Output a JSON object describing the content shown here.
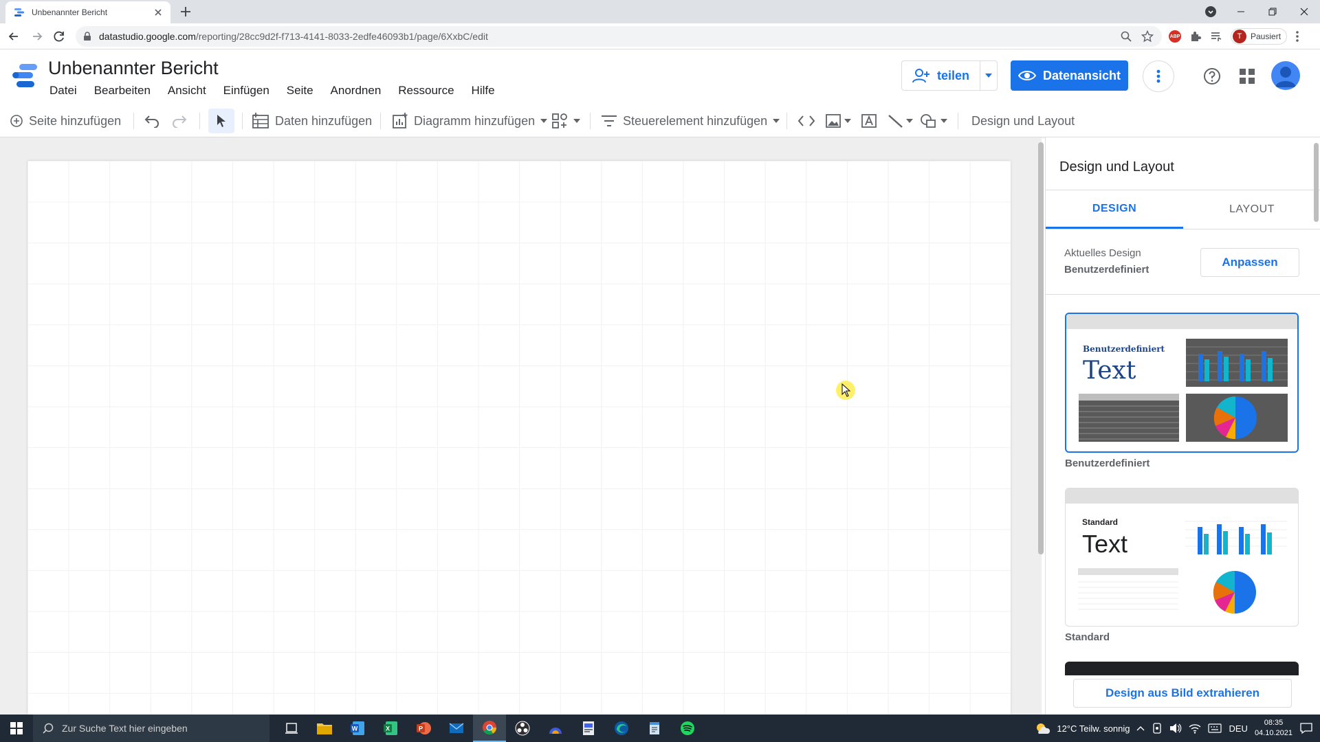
{
  "browser": {
    "tab_title": "Unbenannter Bericht",
    "url_host": "datastudio.google.com",
    "url_path": "/reporting/28cc9d2f-f713-4141-8033-2edfe46093b1/page/6XxbC/edit",
    "profile_initial": "T",
    "profile_status": "Pausiert",
    "abp_label": "ABP"
  },
  "header": {
    "report_title": "Unbenannter Bericht",
    "menu": [
      "Datei",
      "Bearbeiten",
      "Ansicht",
      "Einfügen",
      "Seite",
      "Anordnen",
      "Ressource",
      "Hilfe"
    ],
    "share_label": "teilen",
    "view_label": "Datenansicht"
  },
  "toolbar": {
    "add_page": "Seite hinzufügen",
    "add_data": "Daten hinzufügen",
    "add_chart": "Diagramm hinzufügen",
    "add_control": "Steuerelement hinzufügen",
    "theme_layout": "Design und Layout"
  },
  "panel": {
    "title": "Design und Layout",
    "tabs": [
      "DESIGN",
      "LAYOUT"
    ],
    "active_tab": "DESIGN",
    "current_label": "Aktuelles Design",
    "current_value": "Benutzerdefiniert",
    "customize_label": "Anpassen",
    "themes": [
      {
        "preview_title": "Benutzerdefiniert",
        "preview_text": "Text",
        "name": "Benutzerdefiniert",
        "selected": true
      },
      {
        "preview_title": "Standard",
        "preview_text": "Text",
        "name": "Standard",
        "selected": false
      }
    ],
    "extract_label": "Design aus Bild extrahieren"
  },
  "taskbar": {
    "search_placeholder": "Zur Suche Text hier eingeben",
    "weather": "12°C  Teilw. sonnig",
    "language": "DEU",
    "time": "08:35",
    "date": "04.10.2021"
  },
  "colors": {
    "accent": "#1a73e8",
    "custom_theme_blue": "#1c4587",
    "custom_theme_bg": "#595959"
  }
}
